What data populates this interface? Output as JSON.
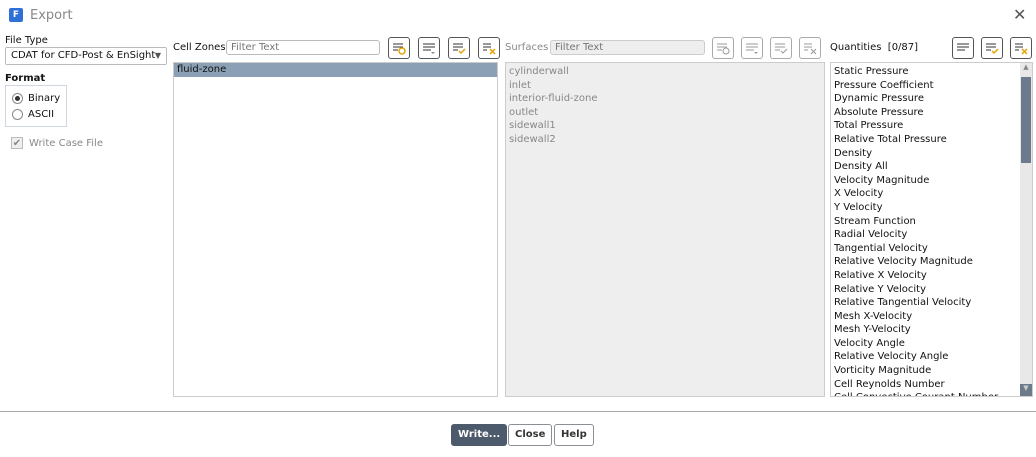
{
  "window": {
    "title": "Export",
    "logo": "F"
  },
  "file_type": {
    "label": "File Type",
    "value": "CDAT for CFD-Post & EnSight"
  },
  "format": {
    "label": "Format",
    "options": [
      "Binary",
      "ASCII"
    ],
    "selected": "Binary"
  },
  "write_case_file": {
    "label": "Write Case File",
    "checked": true
  },
  "cell_zones": {
    "label": "Cell Zones",
    "placeholder": "Filter Text",
    "items": [
      "fluid-zone"
    ],
    "selected": "fluid-zone"
  },
  "surfaces": {
    "label": "Surfaces",
    "placeholder": "Filter Text",
    "items": [
      "cylinderwall",
      "inlet",
      "interior-fluid-zone",
      "outlet",
      "sidewall1",
      "sidewall2"
    ]
  },
  "quantities": {
    "label": "Quantities",
    "count": "[0/87]",
    "items": [
      "Static Pressure",
      "Pressure Coefficient",
      "Dynamic Pressure",
      "Absolute Pressure",
      "Total Pressure",
      "Relative Total Pressure",
      "Density",
      "Density All",
      "Velocity Magnitude",
      "X Velocity",
      "Y Velocity",
      "Stream Function",
      "Radial Velocity",
      "Tangential Velocity",
      "Relative Velocity Magnitude",
      "Relative X Velocity",
      "Relative Y Velocity",
      "Relative Tangential Velocity",
      "Mesh X-Velocity",
      "Mesh Y-Velocity",
      "Velocity Angle",
      "Relative Velocity Angle",
      "Vorticity Magnitude",
      "Cell Reynolds Number",
      "Cell Convective Courant Number"
    ]
  },
  "buttons": {
    "write": "Write...",
    "close": "Close",
    "help": "Help"
  },
  "colors": {
    "accent": "#e5a400",
    "selection": "#8ba0b4",
    "primary_button": "#4d5a6b"
  }
}
